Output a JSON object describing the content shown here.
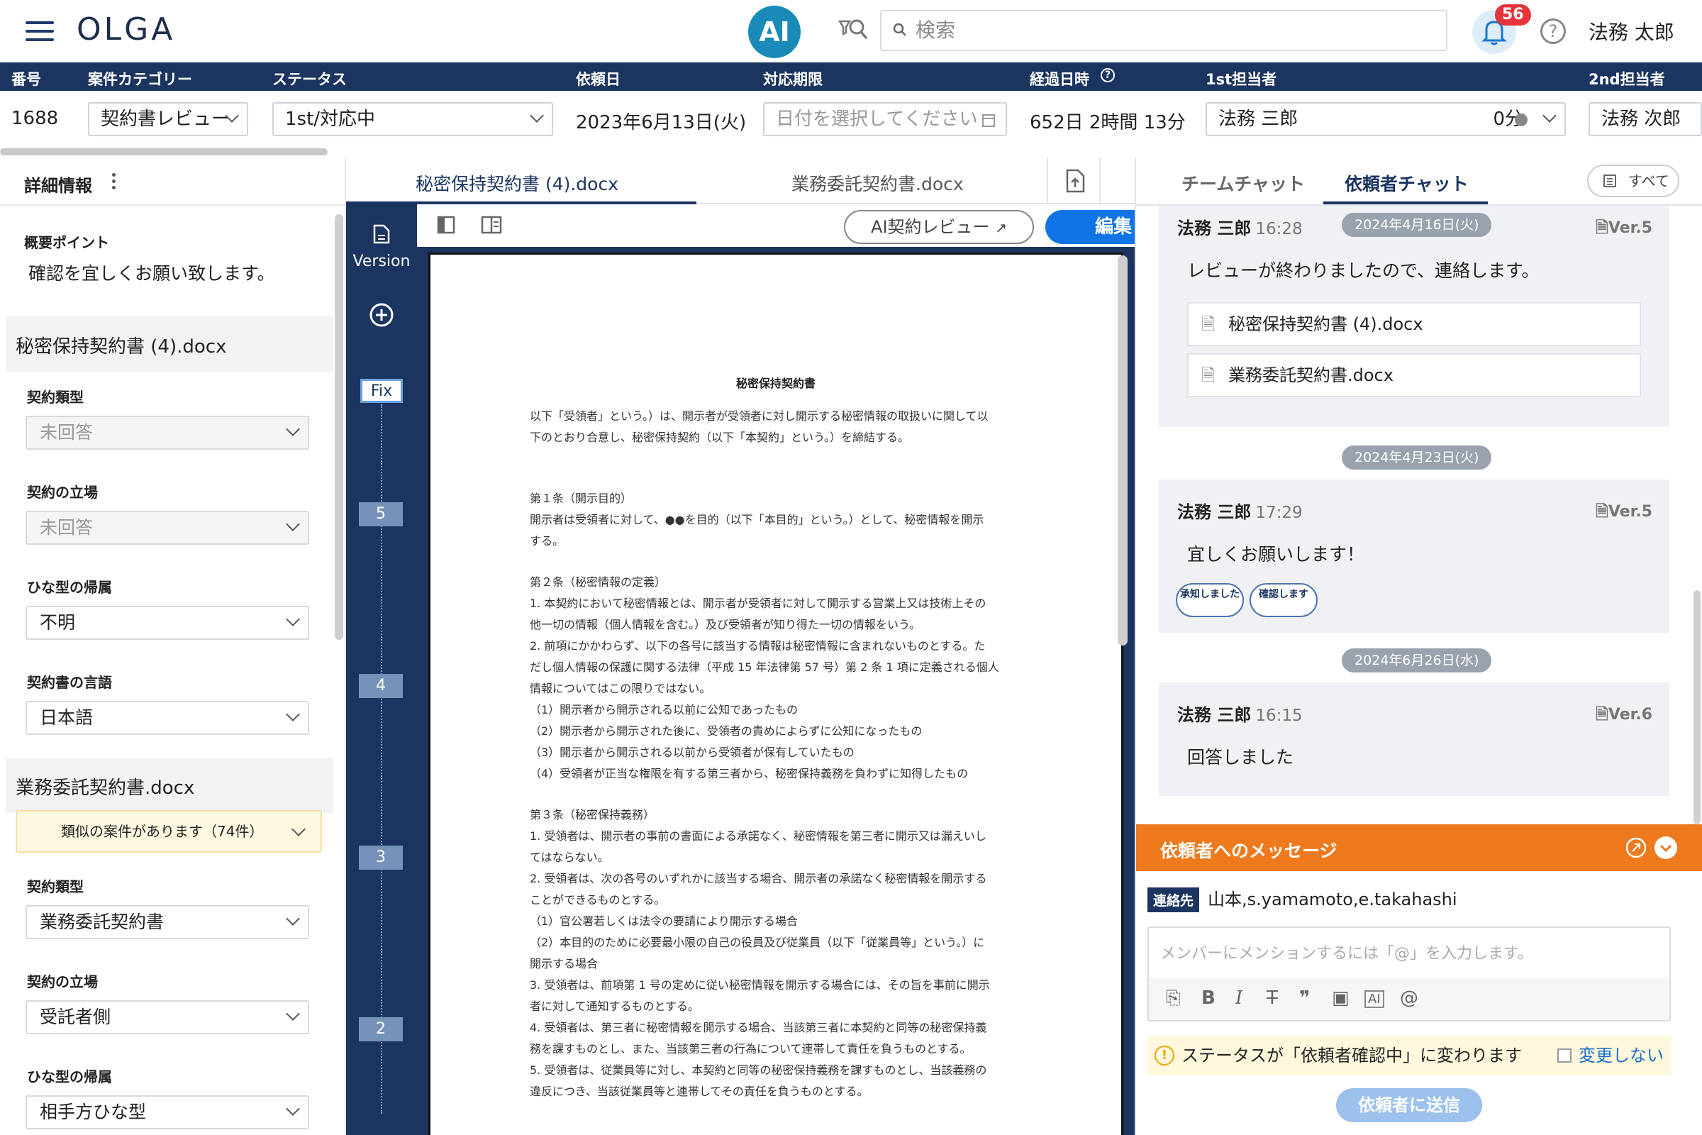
{
  "app": {
    "logo": "OLGA",
    "ai_label": "AI",
    "search_placeholder": "検索",
    "notif_count": "56",
    "help": "?",
    "user_name": "法務 太郎"
  },
  "header": {
    "cols": [
      "番号",
      "案件カテゴリー",
      "ステータス",
      "依頼日",
      "対応期限",
      "経過日時",
      "1st担当者",
      "2nd担当者"
    ],
    "values": {
      "number": "1688",
      "category": "契約書レビュー",
      "status": "1st/対応中",
      "request_date": "2023年6月13日(火)",
      "deadline_placeholder": "日付を選択してください",
      "elapsed": "652日 2時間 13分",
      "first_assignee": "法務 三郎",
      "first_time": "0分",
      "second_assignee": "法務 次郎"
    }
  },
  "left": {
    "title": "詳細情報",
    "summary_label": "概要ポイント",
    "summary_text": "確認を宜しくお願い致します。",
    "doc1": {
      "name": "秘密保持契約書 (4).docx",
      "fields": [
        {
          "label": "契約類型",
          "value": "未回答"
        },
        {
          "label": "契約の立場",
          "value": "未回答"
        },
        {
          "label": "ひな型の帰属",
          "value": "不明"
        },
        {
          "label": "契約書の言語",
          "value": "日本語"
        }
      ]
    },
    "doc2": {
      "name": "業務委託契約書.docx",
      "notice": "類似の案件があります（74件）",
      "fields": [
        {
          "label": "契約類型",
          "value": "業務委託契約書"
        },
        {
          "label": "契約の立場",
          "value": "受託者側"
        },
        {
          "label": "ひな型の帰属",
          "value": "相手方ひな型"
        }
      ]
    }
  },
  "middle": {
    "tabs": [
      "秘密保持契約書 (4).docx",
      "業務委託契約書.docx"
    ],
    "version_label": "Version",
    "fix_label": "Fix",
    "versions": [
      "5",
      "4",
      "3",
      "2"
    ],
    "ai_review": "AI契約レビュー",
    "edit": "編集",
    "doc_title": "秘密保持契約書",
    "doc_lines": [
      "以下「受領者」という。）は、開示者が受領者に対し開示する秘密情報の取扱いに関して以",
      "下のとおり合意し、秘密保持契約（以下「本契約」という。）を締結する。",
      "第１条（開示目的）",
      "開示者は受領者に対して、●●を目的（以下「本目的」という。）として、秘密情報を開示",
      "する。",
      "第２条（秘密情報の定義）",
      "1. 本契約において秘密情報とは、開示者が受領者に対して開示する営業上又は技術上その",
      "他一切の情報（個人情報を含む。）及び受領者が知り得た一切の情報をいう。",
      "2. 前項にかかわらず、以下の各号に該当する情報は秘密情報に含まれないものとする。た",
      "だし個人情報の保護に関する法律（平成 15 年法律第 57 号）第 2 条 1 項に定義される個人",
      "情報についてはこの限りではない。",
      "（1）開示者から開示される以前に公知であったもの",
      "（2）開示者から開示された後に、受領者の責めによらずに公知になったもの",
      "（3）開示者から開示される以前から受領者が保有していたもの",
      "（4）受領者が正当な権限を有する第三者から、秘密保持義務を負わずに知得したもの",
      "第３条（秘密保持義務）",
      "1. 受領者は、開示者の事前の書面による承諾なく、秘密情報を第三者に開示又は漏えいし",
      "てはならない。",
      "2. 受領者は、次の各号のいずれかに該当する場合、開示者の承諾なく秘密情報を開示する",
      "ことができるものとする。",
      "（1）官公署若しくは法令の要請により開示する場合",
      "（2）本目的のために必要最小限の自己の役員及び従業員（以下「従業員等」という。）に",
      "開示する場合",
      "3. 受領者は、前項第 1 号の定めに従い秘密情報を開示する場合には、その旨を事前に開示",
      "者に対して通知するものとする。",
      "4. 受領者は、第三者に秘密情報を開示する場合、当該第三者に本契約と同等の秘密保持義",
      "務を課すものとし、また、当該第三者の行為について連帯して責任を負うものとする。",
      "5. 受領者は、従業員等に対し、本契約と同等の秘密保持義務を課すものとし、当該義務の",
      "違反につき、当該従業員等と連帯してその責任を負うものとする。"
    ]
  },
  "right": {
    "tabs": [
      "チームチャット",
      "依頼者チャット"
    ],
    "all": "すべて",
    "messages": [
      {
        "name": "法務 三郎",
        "time": "16:28",
        "date": "2024年4月16日(火)",
        "ver": "Ver.5",
        "text": "レビューが終わりましたので、連絡します。",
        "files": [
          "秘密保持契約書 (4).docx",
          "業務委託契約書.docx"
        ]
      },
      {
        "name": "法務 三郎",
        "time": "17:29",
        "date": "2024年4月23日(火)",
        "ver": "Ver.5",
        "text": "宜しくお願いします！",
        "reactions": [
          "承知しました",
          "確認します"
        ]
      },
      {
        "name": "法務 三郎",
        "time": "16:15",
        "date": "2024年6月26日(水)",
        "ver": "Ver.6",
        "text": "回答しました"
      }
    ],
    "compose_title": "依頼者へのメッセージ",
    "contact_tag": "連絡先",
    "contact_value": "山本,s.yamamoto,e.takahashi",
    "placeholder": "メンバーにメンションするには「@」を入力します。",
    "status_note": "ステータスが「依頼者確認中」に変わります",
    "no_change": "変更しない",
    "send": "依頼者に送信"
  }
}
